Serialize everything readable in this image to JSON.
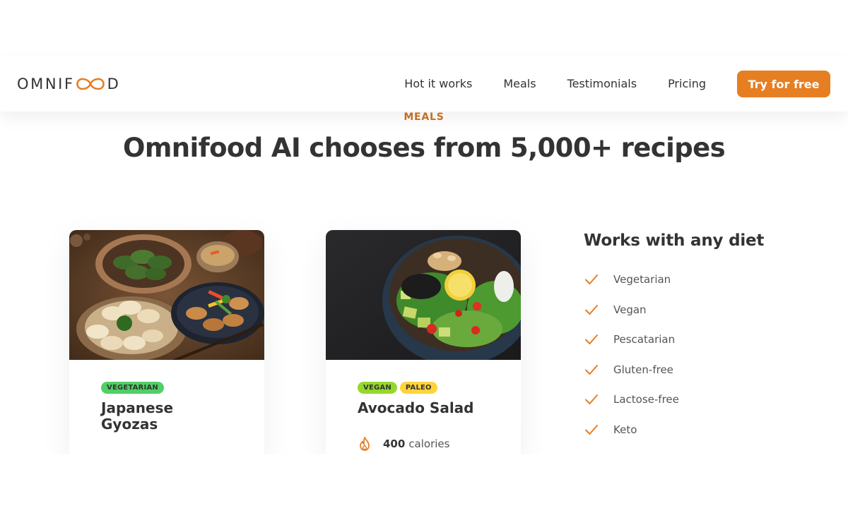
{
  "header": {
    "logo_left": "OMNIF",
    "logo_right": "D",
    "nav": [
      "Hot it works",
      "Meals",
      "Testimonials",
      "Pricing"
    ],
    "cta_label": "Try for free",
    "accent_color": "#e67e22"
  },
  "section": {
    "subheading": "MEALS",
    "title": "Omnifood AI chooses from 5,000+ recipes"
  },
  "meals": [
    {
      "image_icon": "gyoza-photo",
      "tags": [
        "Vegetarian"
      ],
      "title": "Japanese Gyozas"
    },
    {
      "image_icon": "avocado-salad-photo",
      "tags": [
        "Vegan",
        "Paleo"
      ],
      "title": "Avocado Salad",
      "calories_value": "400",
      "calories_unit": "calories",
      "calories_icon": "flame-icon"
    }
  ],
  "diets": {
    "title": "Works with any diet",
    "items": [
      "Vegetarian",
      "Vegan",
      "Pescatarian",
      "Gluten-free",
      "Lactose-free",
      "Keto"
    ],
    "icon": "check-icon"
  }
}
